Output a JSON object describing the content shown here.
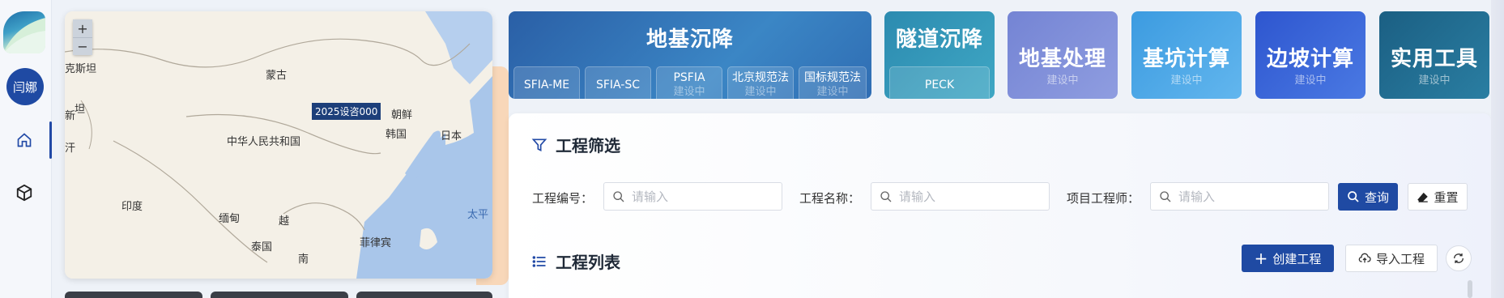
{
  "sidebar": {
    "avatar_text": "闫娜",
    "items": [
      {
        "icon": "home-icon"
      },
      {
        "icon": "cube-icon"
      }
    ]
  },
  "map": {
    "zoom_in": "+",
    "zoom_out": "−",
    "labels": [
      "克斯坦",
      "蒙古",
      "坦",
      "新",
      "汗",
      "中华人民共和国",
      "朝鲜",
      "韩国",
      "日本",
      "印度",
      "缅甸",
      "越",
      "泰国",
      "南",
      "菲律宾",
      "太平"
    ],
    "marker_label": "2025设咨000"
  },
  "modules": {
    "settlement": {
      "title": "地基沉降",
      "subs": [
        {
          "label": "SFIA-ME",
          "status": ""
        },
        {
          "label": "SFIA-SC",
          "status": ""
        },
        {
          "label": "PSFIA",
          "status": "建设中"
        },
        {
          "label": "北京规范法",
          "status": "建设中"
        },
        {
          "label": "国标规范法",
          "status": "建设中"
        }
      ]
    },
    "tunnel": {
      "title": "隧道沉降",
      "subs": [
        {
          "label": "PECK"
        }
      ]
    },
    "treatment": {
      "title": "地基处理",
      "status": "建设中"
    },
    "pit": {
      "title": "基坑计算",
      "status": "建设中"
    },
    "slope": {
      "title": "边坡计算",
      "status": "建设中"
    },
    "tools": {
      "title": "实用工具",
      "status": "建设中"
    }
  },
  "filter": {
    "title": "工程筛选",
    "fields": [
      {
        "label": "工程编号：",
        "placeholder": "请输入"
      },
      {
        "label": "工程名称：",
        "placeholder": "请输入"
      },
      {
        "label": "项目工程师：",
        "placeholder": "请输入"
      }
    ],
    "query_label": "查询",
    "reset_label": "重置"
  },
  "list": {
    "title": "工程列表",
    "create_label": "创建工程",
    "import_label": "导入工程"
  },
  "colors": {
    "primary": "#1f4aa3",
    "tile_settlement": "#2f6db3",
    "tile_tunnel": "#2f8fb0",
    "tile_treatment": "#7b88d6",
    "tile_pit": "#4da6e6",
    "tile_slope": "#3b63d6",
    "tile_tools": "#1f6f8e"
  }
}
